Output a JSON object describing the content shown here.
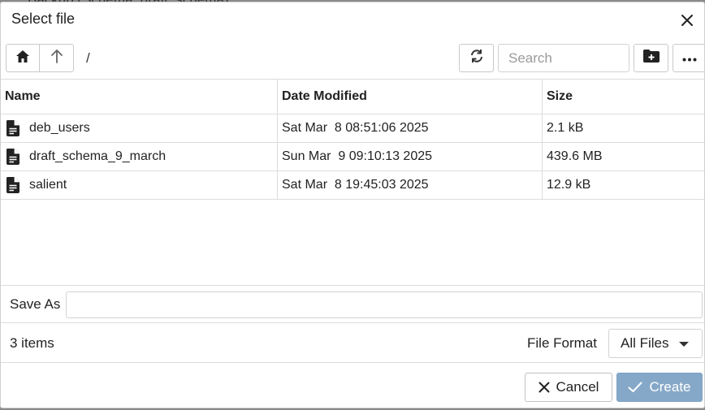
{
  "background": {
    "title": "Backup (Schema: draft_schema)"
  },
  "dialog": {
    "title": "Select file",
    "close_icon": "close-icon"
  },
  "toolbar": {
    "home_icon": "home-icon",
    "up_icon": "arrow-up-icon",
    "path": "/",
    "refresh_icon": "refresh-icon",
    "search_placeholder": "Search",
    "new_folder_icon": "new-folder-icon",
    "more_icon": "more-options-icon"
  },
  "table": {
    "columns": [
      "Name",
      "Date Modified",
      "Size"
    ],
    "rows": [
      {
        "name": "deb_users",
        "date": "Sat Mar  8 08:51:06 2025",
        "size": "2.1 kB",
        "icon": "file-icon"
      },
      {
        "name": "draft_schema_9_march",
        "date": "Sun Mar  9 09:10:13 2025",
        "size": "439.6 MB",
        "icon": "file-icon"
      },
      {
        "name": "salient",
        "date": "Sat Mar  8 19:45:03 2025",
        "size": "12.9 kB",
        "icon": "file-icon"
      }
    ]
  },
  "save_as": {
    "label": "Save As",
    "value": ""
  },
  "status": {
    "items_count": "3 items",
    "format_label": "File Format",
    "format_value": "All Files"
  },
  "footer": {
    "cancel_label": "Cancel",
    "create_label": "Create"
  },
  "colors": {
    "create_button": "#86a8c8",
    "border": "#dcdcdc"
  }
}
